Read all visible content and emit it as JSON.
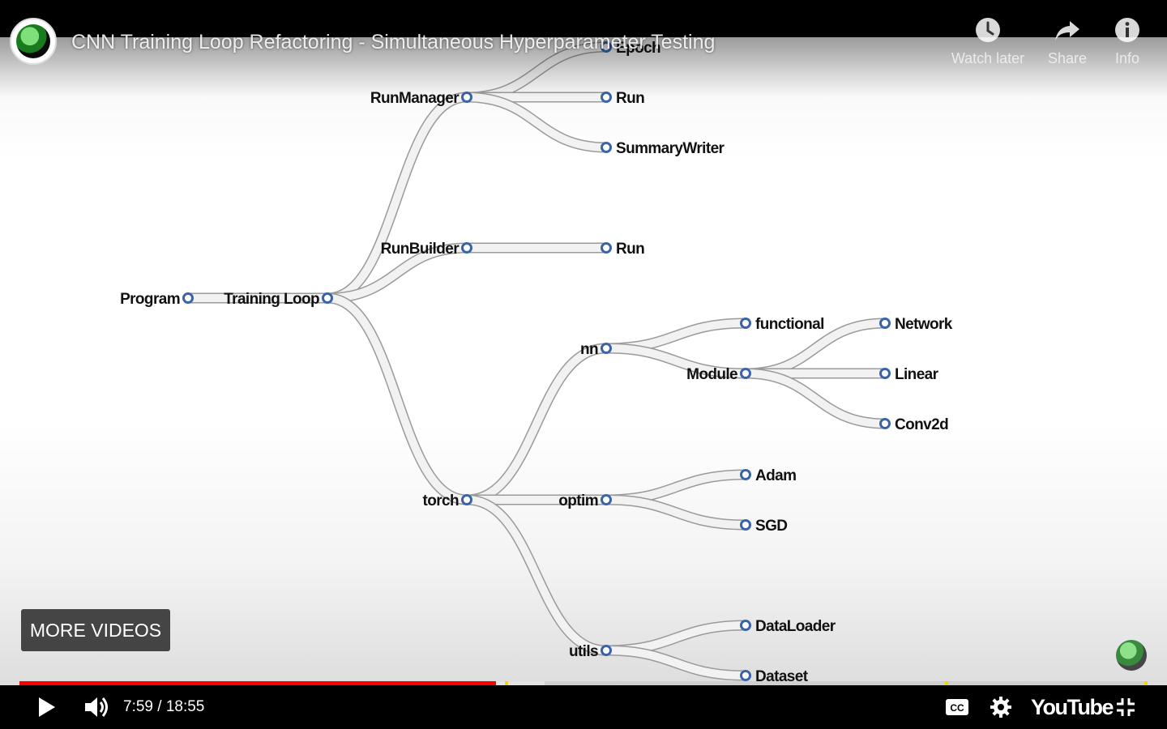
{
  "video": {
    "title": "CNN Training Loop Refactoring - Simultaneous Hyperparameter Testing",
    "time": "7:59 / 18:55",
    "progress_played_fraction": 0.4224,
    "progress_buffered_fraction": 0.4655,
    "chapter_marker_fractions": [
      0.4305,
      0.8204,
      0.9969
    ]
  },
  "top_actions": [
    {
      "label": "Watch later",
      "icon": "clock-icon"
    },
    {
      "label": "Share",
      "icon": "share-arrow-icon"
    },
    {
      "label": "Info",
      "icon": "info-icon"
    }
  ],
  "more_videos_label": "MORE VIDEOS",
  "brand": "YouTube",
  "colors": {
    "progress": "#ff0000",
    "marker": "#f6d400",
    "node_ring": "#3a63a8"
  },
  "tree": {
    "nodes": [
      {
        "id": "program",
        "label": "Program"
      },
      {
        "id": "training_loop",
        "label": "Training Loop"
      },
      {
        "id": "run_manager",
        "label": "RunManager"
      },
      {
        "id": "epoch",
        "label": "Epoch"
      },
      {
        "id": "run_a",
        "label": "Run"
      },
      {
        "id": "summary_writer",
        "label": "SummaryWriter"
      },
      {
        "id": "run_builder",
        "label": "RunBuilder"
      },
      {
        "id": "run_b",
        "label": "Run"
      },
      {
        "id": "torch",
        "label": "torch"
      },
      {
        "id": "nn",
        "label": "nn"
      },
      {
        "id": "functional",
        "label": "functional"
      },
      {
        "id": "module",
        "label": "Module"
      },
      {
        "id": "network",
        "label": "Network"
      },
      {
        "id": "linear",
        "label": "Linear"
      },
      {
        "id": "conv2d",
        "label": "Conv2d"
      },
      {
        "id": "optim",
        "label": "optim"
      },
      {
        "id": "adam",
        "label": "Adam"
      },
      {
        "id": "sgd",
        "label": "SGD"
      },
      {
        "id": "utils",
        "label": "utils"
      },
      {
        "id": "dataloader",
        "label": "DataLoader"
      },
      {
        "id": "dataset",
        "label": "Dataset"
      }
    ],
    "edges": [
      [
        "program",
        "training_loop"
      ],
      [
        "training_loop",
        "run_manager"
      ],
      [
        "training_loop",
        "run_builder"
      ],
      [
        "training_loop",
        "torch"
      ],
      [
        "run_manager",
        "epoch"
      ],
      [
        "run_manager",
        "run_a"
      ],
      [
        "run_manager",
        "summary_writer"
      ],
      [
        "run_builder",
        "run_b"
      ],
      [
        "torch",
        "nn"
      ],
      [
        "torch",
        "optim"
      ],
      [
        "torch",
        "utils"
      ],
      [
        "nn",
        "functional"
      ],
      [
        "nn",
        "module"
      ],
      [
        "module",
        "network"
      ],
      [
        "module",
        "linear"
      ],
      [
        "module",
        "conv2d"
      ],
      [
        "optim",
        "adam"
      ],
      [
        "optim",
        "sgd"
      ],
      [
        "utils",
        "dataloader"
      ],
      [
        "utils",
        "dataset"
      ]
    ]
  }
}
